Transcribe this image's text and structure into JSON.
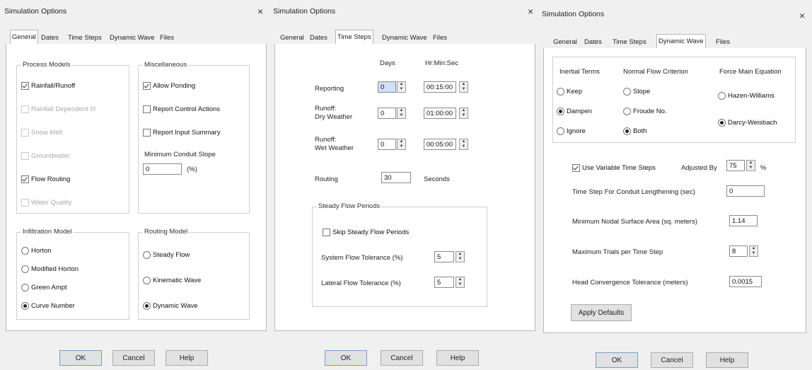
{
  "common": {
    "dialog_title": "Simulation Options",
    "close_glyph": "×",
    "tabs": [
      "General",
      "Dates",
      "Time Steps",
      "Dynamic Wave",
      "Files"
    ],
    "buttons": {
      "ok": "OK",
      "cancel": "Cancel",
      "help": "Help"
    }
  },
  "general": {
    "process_models": {
      "title": "Process Models",
      "items": [
        {
          "label": "Rainfall/Runoff",
          "checked": true,
          "enabled": true
        },
        {
          "label": "Rainfall Dependent I/I",
          "checked": false,
          "enabled": false
        },
        {
          "label": "Snow Melt",
          "checked": false,
          "enabled": false
        },
        {
          "label": "Groundwater",
          "checked": false,
          "enabled": false
        },
        {
          "label": "Flow Routing",
          "checked": true,
          "enabled": true
        },
        {
          "label": "Water Quality",
          "checked": false,
          "enabled": false
        }
      ]
    },
    "misc": {
      "title": "Miscellaneous",
      "items": [
        {
          "label": "Allow Ponding",
          "checked": true
        },
        {
          "label": "Report Control Actions",
          "checked": false
        },
        {
          "label": "Report Input Summary",
          "checked": false
        }
      ],
      "min_slope_label": "Minimum Conduit Slope",
      "min_slope_value": "0",
      "min_slope_unit": "(%)"
    },
    "infiltration": {
      "title": "Infiltration Model",
      "options": [
        "Horton",
        "Modified Horton",
        "Green Ampt",
        "Curve Number"
      ],
      "selected": "Curve Number"
    },
    "routing": {
      "title": "Routing Model",
      "options": [
        "Steady Flow",
        "Kinematic Wave",
        "Dynamic Wave"
      ],
      "selected": "Dynamic Wave"
    }
  },
  "timesteps": {
    "col_days": "Days",
    "col_hms": "Hr:Min:Sec",
    "reporting_label": "Reporting",
    "reporting_days": "0",
    "reporting_hms": "00:15:00",
    "runoff_dry_label_1": "Runoff:",
    "runoff_dry_label_2": "Dry Weather",
    "runoff_dry_days": "0",
    "runoff_dry_hms": "01:00:00",
    "runoff_wet_label_1": "Runoff:",
    "runoff_wet_label_2": "Wet Weather",
    "runoff_wet_days": "0",
    "runoff_wet_hms": "00:05:00",
    "routing_label": "Routing",
    "routing_value": "30",
    "routing_unit": "Seconds",
    "steady": {
      "title": "Steady Flow Periods",
      "skip_label": "Skip Steady Flow Periods",
      "skip_checked": false,
      "system_tol_label": "System Flow Tolerance (%)",
      "system_tol_value": "5",
      "lateral_tol_label": "Lateral Flow Tolerance (%)",
      "lateral_tol_value": "5"
    }
  },
  "dynamic": {
    "inertial": {
      "title": "Inertial Terms",
      "options": [
        "Keep",
        "Dampen",
        "Ignore"
      ],
      "selected": "Dampen"
    },
    "normal_flow": {
      "title": "Normal Flow Criterion",
      "options": [
        "Slope",
        "Froude No.",
        "Both"
      ],
      "selected": "Both"
    },
    "force_main": {
      "title": "Force Main Equation",
      "options": [
        "Hazen-Williams",
        "Darcy-Weisbach"
      ],
      "selected": "Darcy-Weisbach"
    },
    "variable_ts_label": "Use Variable Time Steps",
    "variable_ts_checked": true,
    "adjusted_by_label": "Adjusted By",
    "adjusted_by_value": "75",
    "adjusted_unit": "%",
    "lengthening_label": "Time Step For Conduit Lengthening (sec)",
    "lengthening_value": "0",
    "min_area_label": "Minimum Nodal Surface Area (sq. meters)",
    "min_area_value": "1.14",
    "max_trials_label": "Maximum Trials per Time Step",
    "max_trials_value": "8",
    "head_tol_label": "Head Convergence Tolerance (meters)",
    "head_tol_value": "0.0015",
    "apply_defaults": "Apply Defaults"
  }
}
